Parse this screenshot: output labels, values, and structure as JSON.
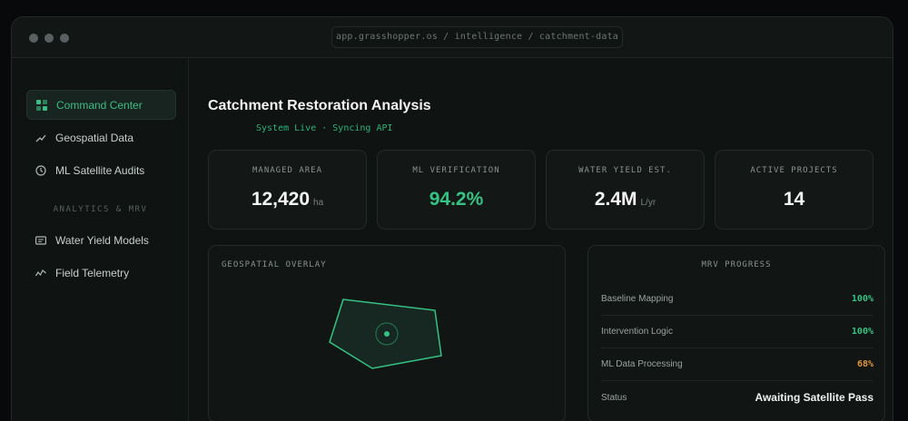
{
  "window": {
    "url": "app.grasshopper.os / intelligence / catchment-data"
  },
  "sidebar": {
    "items": [
      {
        "label": "Command Center",
        "icon": "grid-icon",
        "active": true
      },
      {
        "label": "Geospatial Data",
        "icon": "trend-line-icon"
      },
      {
        "label": "ML Satellite Audits",
        "icon": "clock-icon"
      }
    ],
    "section_label": "ANALYTICS & MRV",
    "section_items": [
      {
        "label": "Water Yield Models",
        "icon": "card-icon"
      },
      {
        "label": "Field Telemetry",
        "icon": "activity-icon"
      }
    ]
  },
  "header": {
    "title": "Catchment Restoration Analysis",
    "status": "System Live · Syncing API"
  },
  "metrics": [
    {
      "label": "MANAGED AREA",
      "value": "12,420",
      "unit": "ha"
    },
    {
      "label": "ML VERIFICATION",
      "value": "94.2%",
      "unit": ""
    },
    {
      "label": "WATER YIELD EST.",
      "value": "2.4M",
      "unit": "L/yr"
    },
    {
      "label": "ACTIVE PROJECTS",
      "value": "14",
      "unit": ""
    }
  ],
  "geospatial": {
    "title": "GEOSPATIAL OVERLAY"
  },
  "mrv": {
    "title": "MRV PROGRESS",
    "rows": [
      {
        "label": "Baseline Mapping",
        "value": "100%"
      },
      {
        "label": "Intervention Logic",
        "value": "100%"
      },
      {
        "label": "ML Data Processing",
        "value": "68%"
      },
      {
        "label": "Status",
        "value": "Awaiting Satellite Pass"
      }
    ]
  },
  "colors": {
    "accent": "#36c285",
    "warning": "#e0943c",
    "background": "#0f1312"
  }
}
